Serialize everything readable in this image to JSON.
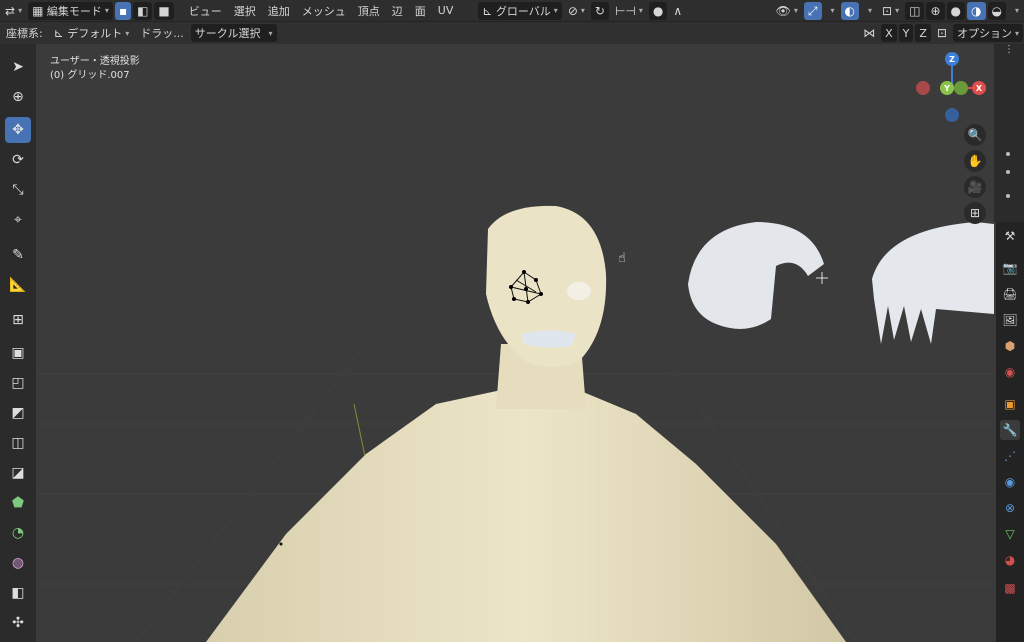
{
  "header": {
    "mode": "編集モード",
    "menus": [
      "ビュー",
      "選択",
      "追加",
      "メッシュ",
      "頂点",
      "辺",
      "面",
      "UV"
    ],
    "transform_orientation": "グローバル"
  },
  "subheader": {
    "coordinate_label": "座標系:",
    "orientation_value": "デフォルト",
    "drag_label": "ドラッ...",
    "select_mode": "サークル選択",
    "axes": [
      "X",
      "Y",
      "Z"
    ],
    "options_label": "オプション"
  },
  "viewport": {
    "view_name": "ユーザー・透視投影",
    "object_name": "(0) グリッド.007"
  },
  "gizmo": {
    "x": "X",
    "y": "Y",
    "z": "Z"
  },
  "colors": {
    "active": "#4772b3",
    "x_axis": "#e04d4d",
    "y_axis": "#8bc34a",
    "z_axis": "#3d7fd6",
    "mesh": "#eae2c4"
  }
}
